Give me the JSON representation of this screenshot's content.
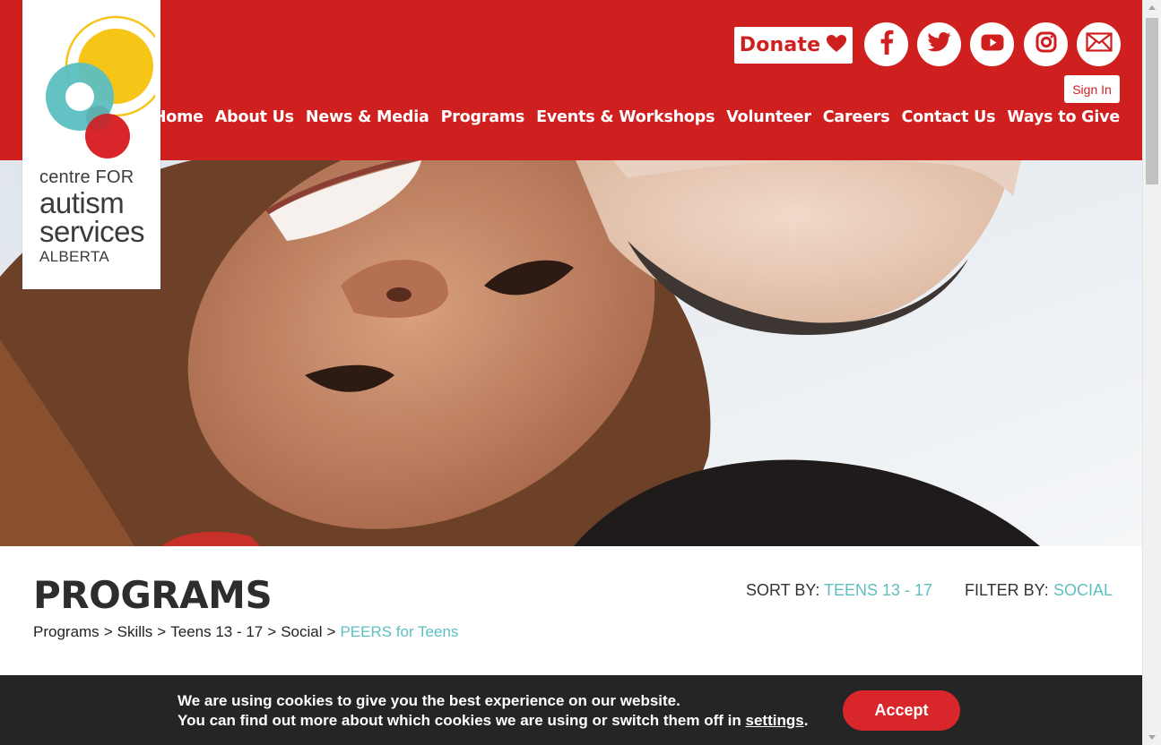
{
  "brand": {
    "name_line1": "centre FOR",
    "name_line2": "autism",
    "name_line3": "services",
    "name_line4": "ALBERTA",
    "colors": {
      "primary_red": "#d01f1f",
      "teal": "#5fbfc0",
      "yellow": "#f5c518",
      "dark": "#252525"
    }
  },
  "header": {
    "donate_label": "Donate",
    "signin_label": "Sign In",
    "social_icons": [
      "facebook-icon",
      "twitter-icon",
      "youtube-icon",
      "instagram-icon",
      "email-icon"
    ]
  },
  "nav": {
    "items": [
      {
        "label": "Home"
      },
      {
        "label": "About Us"
      },
      {
        "label": "News & Media"
      },
      {
        "label": "Programs"
      },
      {
        "label": "Events & Workshops"
      },
      {
        "label": "Volunteer"
      },
      {
        "label": "Careers"
      },
      {
        "label": "Contact Us"
      },
      {
        "label": "Ways to Give"
      }
    ]
  },
  "main": {
    "title": "PROGRAMS",
    "sort_label": "SORT BY:",
    "sort_value": "TEENS 13 - 17",
    "filter_label": "FILTER BY:",
    "filter_value": "SOCIAL",
    "breadcrumb": [
      {
        "label": "Programs"
      },
      {
        "label": "Skills"
      },
      {
        "label": "Teens 13 - 17"
      },
      {
        "label": "Social"
      },
      {
        "label": "PEERS for Teens"
      }
    ],
    "breadcrumb_separator": ">"
  },
  "cookie": {
    "line1": "We are using cookies to give you the best experience on our website.",
    "line2_prefix": "You can find out more about which cookies we are using or switch them off in",
    "settings_link": "settings",
    "line2_suffix": ".",
    "accept_label": "Accept"
  }
}
